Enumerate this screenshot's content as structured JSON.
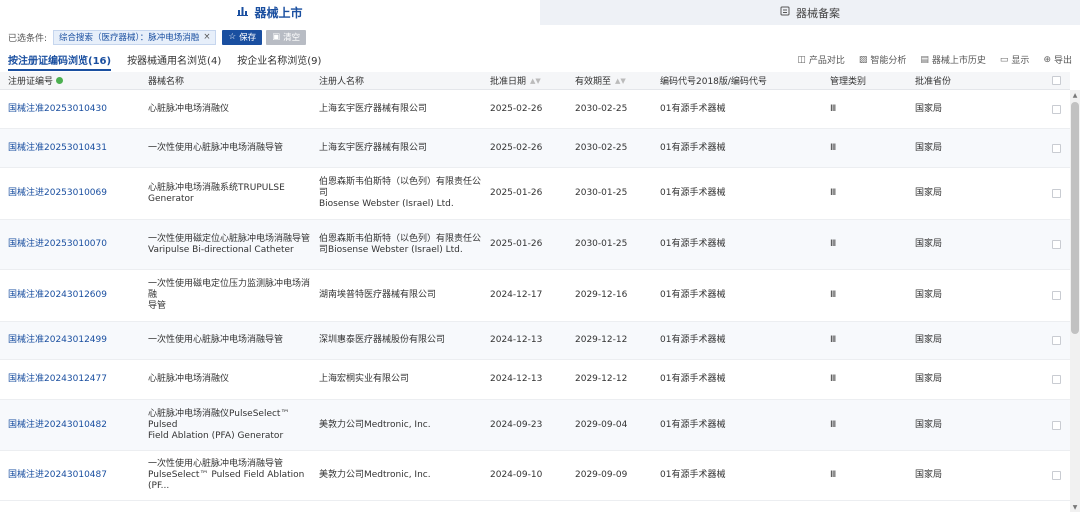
{
  "top_tabs": [
    {
      "label": "器械上市",
      "icon": "chart-icon"
    },
    {
      "label": "器械备案",
      "icon": "document-icon"
    }
  ],
  "filter": {
    "label": "已选条件:",
    "chip": "综合搜索（医疗器械）：脉冲电场消融",
    "save_label": "保存",
    "clear_label": "清空"
  },
  "sub_tabs": [
    "按注册证编码浏览(16)",
    "按器械通用名浏览(4)",
    "按企业名称浏览(9)"
  ],
  "toolbar": [
    {
      "label": "产品对比",
      "icon": "compare-icon"
    },
    {
      "label": "智能分析",
      "icon": "analysis-icon"
    },
    {
      "label": "器械上市历史",
      "icon": "history-icon"
    },
    {
      "label": "显示",
      "icon": "display-icon"
    },
    {
      "label": "导出",
      "icon": "export-icon"
    }
  ],
  "table": {
    "headers": [
      "注册证编号",
      "器械名称",
      "注册人名称",
      "批准日期",
      "有效期至",
      "编码代号2018版/编码代号",
      "管理类别",
      "批准省份"
    ],
    "rows": [
      {
        "reg": "国械注准20253010430",
        "name": [
          "心脏脉冲电场消融仪"
        ],
        "company": [
          "上海玄宇医疗器械有限公司"
        ],
        "approve": "2025-02-26",
        "valid": "2030-02-25",
        "code": "01有源手术器械",
        "cls": "Ⅲ",
        "prov": "国家局"
      },
      {
        "reg": "国械注准20253010431",
        "name": [
          "一次性使用心脏脉冲电场消融导管"
        ],
        "company": [
          "上海玄宇医疗器械有限公司"
        ],
        "approve": "2025-02-26",
        "valid": "2030-02-25",
        "code": "01有源手术器械",
        "cls": "Ⅲ",
        "prov": "国家局"
      },
      {
        "reg": "国械注进20253010069",
        "name": [
          "心脏脉冲电场消融系统TRUPULSE",
          "Generator"
        ],
        "company": [
          "伯恩森斯韦伯斯特（以色列）有限责任公司",
          "Biosense Webster (Israel) Ltd."
        ],
        "approve": "2025-01-26",
        "valid": "2030-01-25",
        "code": "01有源手术器械",
        "cls": "Ⅲ",
        "prov": "国家局"
      },
      {
        "reg": "国械注进20253010070",
        "name": [
          "一次性使用磁定位心脏脉冲电场消融导管",
          "Varipulse Bi-directional Catheter"
        ],
        "company": [
          "伯恩森斯韦伯斯特（以色列）有限责任公",
          "司Biosense Webster (Israel) Ltd."
        ],
        "approve": "2025-01-26",
        "valid": "2030-01-25",
        "code": "01有源手术器械",
        "cls": "Ⅲ",
        "prov": "国家局"
      },
      {
        "reg": "国械注准20243012609",
        "name": [
          "一次性使用磁电定位压力监测脉冲电场消融",
          "导管"
        ],
        "company": [
          "湖南埃普特医疗器械有限公司"
        ],
        "approve": "2024-12-17",
        "valid": "2029-12-16",
        "code": "01有源手术器械",
        "cls": "Ⅲ",
        "prov": "国家局"
      },
      {
        "reg": "国械注准20243012499",
        "name": [
          "一次性使用心脏脉冲电场消融导管"
        ],
        "company": [
          "深圳惠泰医疗器械股份有限公司"
        ],
        "approve": "2024-12-13",
        "valid": "2029-12-12",
        "code": "01有源手术器械",
        "cls": "Ⅲ",
        "prov": "国家局"
      },
      {
        "reg": "国械注准20243012477",
        "name": [
          "心脏脉冲电场消融仪"
        ],
        "company": [
          "上海宏桐实业有限公司"
        ],
        "approve": "2024-12-13",
        "valid": "2029-12-12",
        "code": "01有源手术器械",
        "cls": "Ⅲ",
        "prov": "国家局"
      },
      {
        "reg": "国械注进20243010482",
        "name": [
          "心脏脉冲电场消融仪PulseSelect™ Pulsed",
          "Field Ablation (PFA) Generator"
        ],
        "company": [
          "美敦力公司Medtronic, Inc."
        ],
        "approve": "2024-09-23",
        "valid": "2029-09-04",
        "code": "01有源手术器械",
        "cls": "Ⅲ",
        "prov": "国家局"
      },
      {
        "reg": "国械注进20243010487",
        "name": [
          "一次性使用心脏脉冲电场消融导管",
          "PulseSelect™ Pulsed Field Ablation (PF..."
        ],
        "company": [
          "美敦力公司Medtronic, Inc."
        ],
        "approve": "2024-09-10",
        "valid": "2029-09-09",
        "code": "01有源手术器械",
        "cls": "Ⅲ",
        "prov": "国家局"
      }
    ]
  }
}
